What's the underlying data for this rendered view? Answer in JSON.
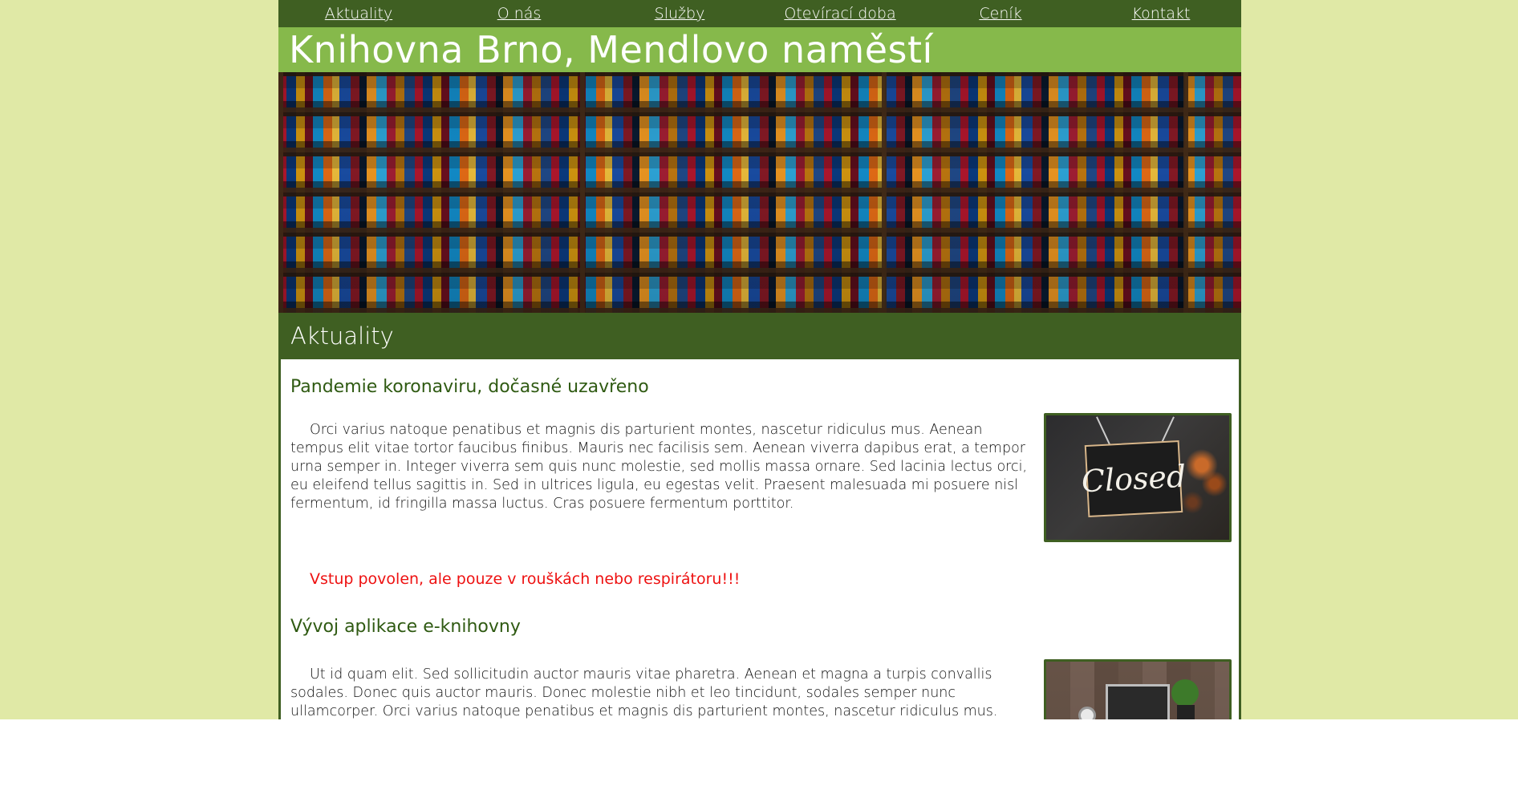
{
  "nav": {
    "items": [
      {
        "label": "Aktuality"
      },
      {
        "label": "O nás"
      },
      {
        "label": "Služby"
      },
      {
        "label": "Otevírací doba"
      },
      {
        "label": "Ceník"
      },
      {
        "label": "Kontakt"
      }
    ]
  },
  "header": {
    "title": "Knihovna Brno, Mendlovo naměstí"
  },
  "section": {
    "title": "Aktuality"
  },
  "articles": [
    {
      "title": "Pandemie koronaviru, dočasné uzavřeno",
      "text": "Orci varius natoque penatibus et magnis dis parturient montes, nascetur ridiculus mus. Aenean tempus elit vitae tortor faucibus finibus. Mauris nec facilisis sem. Aenean viverra dapibus erat, a tempor urna semper in. Integer viverra sem quis nunc molestie, sed mollis massa ornare. Sed lacinia lectus orci, eu eleifend tellus sagittis in. Sed in ultrices ligula, eu egestas velit. Praesent malesuada mi posuere nisl fermentum, id fringilla massa luctus. Cras posuere fermentum porttitor.",
      "image_sign_text": "Closed",
      "notice": "Vstup povolen, ale pouze v rouškách nebo respirátoru!!!"
    },
    {
      "title": "Vývoj aplikace e-knihovny",
      "text": "Ut id quam elit. Sed sollicitudin auctor mauris vitae pharetra. Aenean et magna a turpis convallis sodales. Donec quis auctor mauris. Donec molestie nibh et leo tincidunt, sodales semper nunc ullamcorper. Orci varius natoque penatibus et magnis dis parturient montes, nascetur ridiculus mus. Aliquam massa justo, auctor at nisl"
    }
  ],
  "colors": {
    "page_bg": "#e0e9a6",
    "nav_bg": "#3f5f22",
    "title_bg": "#86b94b",
    "heading_text": "#2f5a12",
    "notice_text": "#ee1111"
  }
}
